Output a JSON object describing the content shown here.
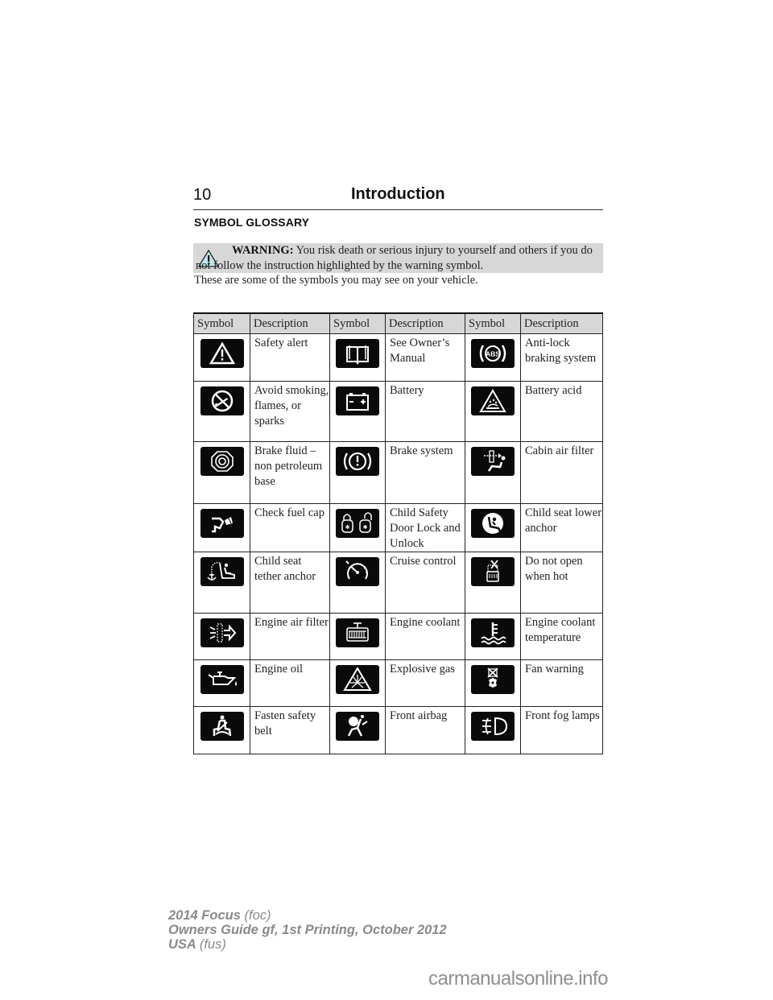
{
  "header": {
    "page_number": "10",
    "chapter_title": "Introduction"
  },
  "section_title": "SYMBOL GLOSSARY",
  "warning": {
    "icon": "warning-triangle-icon",
    "label": "WARNING:",
    "text": "You risk death or serious injury to yourself and others if you do not follow the instruction highlighted by the warning symbol."
  },
  "intro_text": "These are some of the symbols you may see on your vehicle.",
  "table": {
    "headers": [
      "Symbol",
      "Description",
      "Symbol",
      "Description",
      "Symbol",
      "Description"
    ],
    "rows": [
      [
        {
          "icon": "safety-alert-icon",
          "description": "Safety alert"
        },
        {
          "icon": "owners-manual-icon",
          "description": "See Owner’s Manual"
        },
        {
          "icon": "abs-icon",
          "description": "Anti-lock braking system"
        }
      ],
      [
        {
          "icon": "no-smoking-flames-icon",
          "description": "Avoid smoking, flames, or sparks"
        },
        {
          "icon": "battery-icon",
          "description": "Battery"
        },
        {
          "icon": "battery-acid-icon",
          "description": "Battery acid"
        }
      ],
      [
        {
          "icon": "brake-fluid-icon",
          "description": "Brake fluid – non petroleum base"
        },
        {
          "icon": "brake-system-icon",
          "description": "Brake system"
        },
        {
          "icon": "cabin-air-filter-icon",
          "description": "Cabin air filter"
        }
      ],
      [
        {
          "icon": "check-fuel-cap-icon",
          "description": "Check fuel cap"
        },
        {
          "icon": "child-safety-lock-icon",
          "description": "Child Safety Door Lock and Unlock"
        },
        {
          "icon": "child-seat-lower-anchor-icon",
          "description": "Child seat lower anchor"
        }
      ],
      [
        {
          "icon": "child-seat-tether-anchor-icon",
          "description": "Child seat tether anchor"
        },
        {
          "icon": "cruise-control-icon",
          "description": "Cruise control"
        },
        {
          "icon": "do-not-open-hot-icon",
          "description": "Do not open when hot"
        }
      ],
      [
        {
          "icon": "engine-air-filter-icon",
          "description": "Engine air filter"
        },
        {
          "icon": "engine-coolant-icon",
          "description": "Engine coolant"
        },
        {
          "icon": "engine-coolant-temperature-icon",
          "description": "Engine coolant temperature"
        }
      ],
      [
        {
          "icon": "engine-oil-icon",
          "description": "Engine oil"
        },
        {
          "icon": "explosive-gas-icon",
          "description": "Explosive gas"
        },
        {
          "icon": "fan-warning-icon",
          "description": "Fan warning"
        }
      ],
      [
        {
          "icon": "fasten-safety-belt-icon",
          "description": "Fasten safety belt"
        },
        {
          "icon": "front-airbag-icon",
          "description": "Front airbag"
        },
        {
          "icon": "front-fog-lamps-icon",
          "description": "Front fog lamps"
        }
      ]
    ]
  },
  "footer": {
    "line1_bold": "2014 Focus",
    "line1_light": "(foc)",
    "line2": "Owners Guide gf, 1st Printing, October 2012",
    "line3_bold": "USA",
    "line3_light": "(fus)"
  },
  "watermark": "carmanualsonline.info"
}
